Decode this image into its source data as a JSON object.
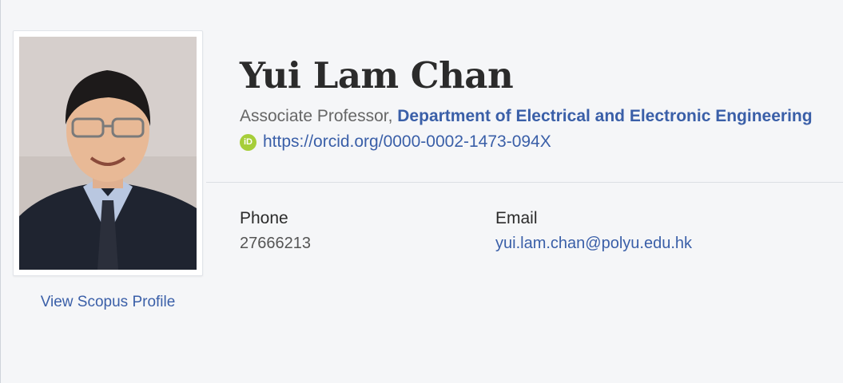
{
  "profile": {
    "name": "Yui Lam Chan",
    "position": "Associate Professor,",
    "department": "Department of Electrical and Electronic Engineering",
    "orcid_url": "https://orcid.org/0000-0002-1473-094X",
    "orcid_icon_text": "iD",
    "scopus_link": "View Scopus Profile"
  },
  "contact": {
    "phone_label": "Phone",
    "phone_value": "27666213",
    "email_label": "Email",
    "email_value": "yui.lam.chan@polyu.edu.hk"
  },
  "colors": {
    "background": "#f5f6f8",
    "link": "#3a5fa8",
    "orcid": "#a6ce39"
  }
}
